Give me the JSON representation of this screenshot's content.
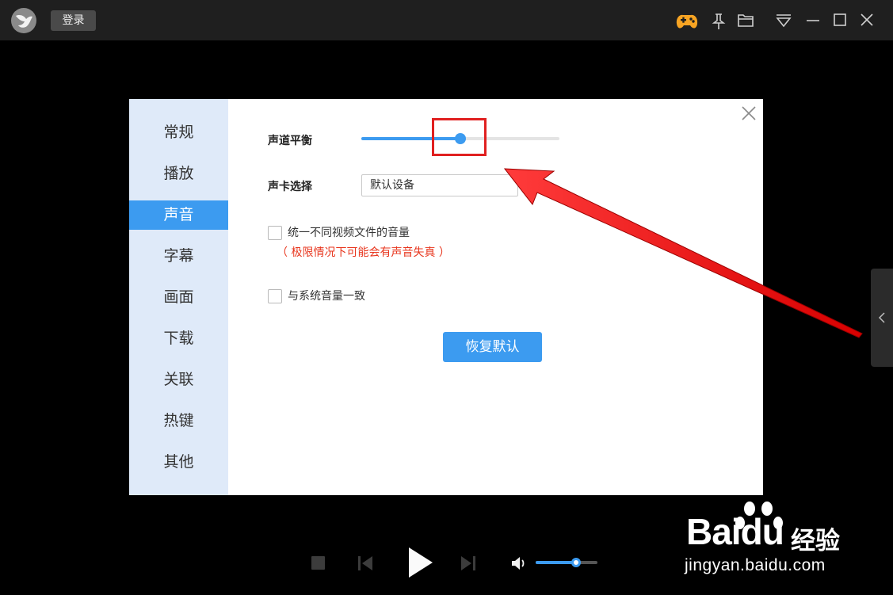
{
  "titlebar": {
    "login_label": "登录",
    "icons": [
      "app-logo",
      "game-icon",
      "pin-icon",
      "folder-icon",
      "menu-icon",
      "minimize-icon",
      "maximize-icon",
      "close-icon"
    ]
  },
  "settings": {
    "nav": [
      "常规",
      "播放",
      "声音",
      "字幕",
      "画面",
      "下载",
      "关联",
      "热键",
      "其他"
    ],
    "active_nav": "声音",
    "channel_balance": {
      "label": "声道平衡",
      "value": 0.5
    },
    "sound_card": {
      "label": "声卡选择",
      "value": "默认设备"
    },
    "unify_volume": {
      "label": "统一不同视频文件的音量",
      "checked": false,
      "warning": "（ 极限情况下可能会有声音失真 ）"
    },
    "system_volume": {
      "label": "与系统音量一致",
      "checked": false
    },
    "restore_label": "恢复默认"
  },
  "player": {
    "volume": 0.66,
    "icons": [
      "stop-icon",
      "previous-icon",
      "play-icon",
      "next-icon",
      "volume-icon"
    ]
  },
  "watermark": {
    "brand": "Bai",
    "brand_tail": "du",
    "cn": "经验",
    "url": "jingyan.baidu.com"
  },
  "colors": {
    "accent": "#3c9bf0",
    "annotation": "#e02020",
    "warning": "#e8361e"
  }
}
